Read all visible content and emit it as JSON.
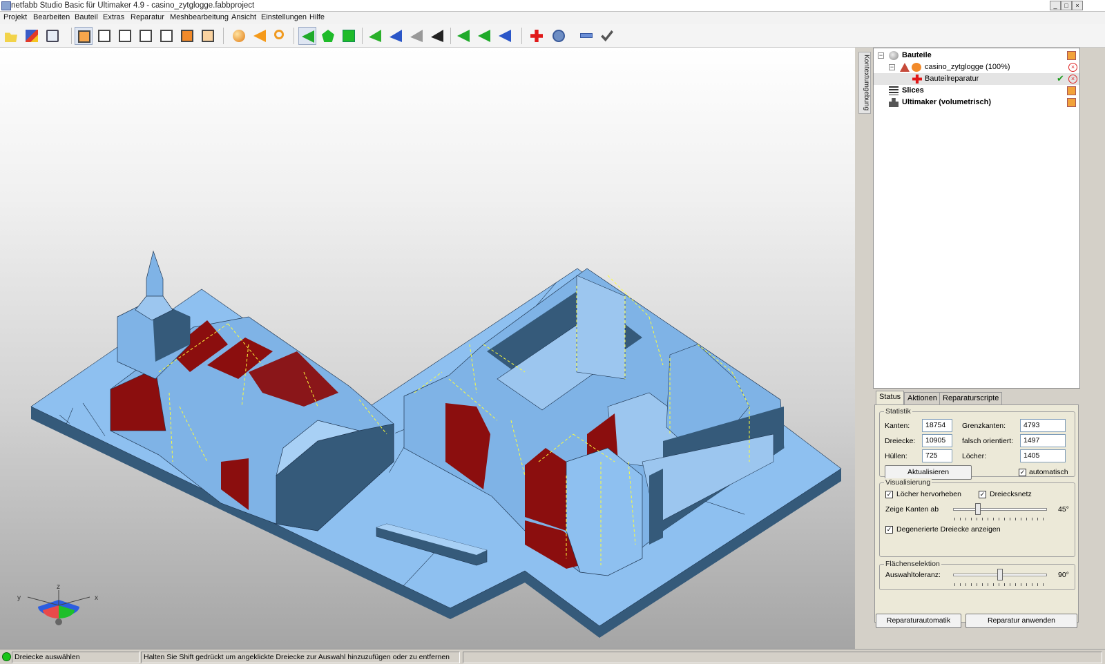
{
  "window": {
    "title": "netfabb Studio Basic für Ultimaker 4.9 - casino_zytglogge.fabbproject"
  },
  "menu": [
    "Projekt",
    "Bearbeiten",
    "Bauteil",
    "Extras",
    "Reparatur",
    "Meshbearbeitung",
    "Ansicht",
    "Einstellungen",
    "Hilfe"
  ],
  "toolbar": {
    "icons": [
      "open-folder-icon",
      "add-part-icon",
      "part-info-icon",
      "view-standard-icon",
      "view-front-icon",
      "view-back-icon",
      "view-left-icon",
      "view-right-icon",
      "view-top-icon",
      "view-bottom-icon",
      "sphere-render-icon",
      "pointer-icon",
      "zoom-icon",
      "select-triangle-icon",
      "select-shell-icon",
      "select-surface-icon",
      "add-triangle-icon",
      "add-triangle-point-icon",
      "remove-triangle-icon",
      "triangle-tool-icon",
      "move-left-icon",
      "move-mid-icon",
      "move-right-icon",
      "repair-cross-icon",
      "measure-dropdown-icon",
      "ruler-icon",
      "check-icon"
    ]
  },
  "sidetab": {
    "label": "Kontextumgebung"
  },
  "tree": {
    "items": [
      {
        "label": "Bauteile",
        "bold": true,
        "level": 0
      },
      {
        "label": "casino_zytglogge (100%)",
        "bold": false,
        "level": 1
      },
      {
        "label": "Bauteilreparatur",
        "bold": false,
        "level": 2
      },
      {
        "label": "Slices",
        "bold": true,
        "level": 0
      },
      {
        "label": "Ultimaker (volumetrisch)",
        "bold": true,
        "level": 0
      }
    ]
  },
  "tabs": [
    "Status",
    "Aktionen",
    "Reparaturscripte"
  ],
  "statistik": {
    "title": "Statistik",
    "kanten_label": "Kanten:",
    "kanten": "18754",
    "grenzkanten_label": "Grenzkanten:",
    "grenzkanten": "4793",
    "dreiecke_label": "Dreiecke:",
    "dreiecke": "10905",
    "falsch_label": "falsch orientiert:",
    "falsch": "1497",
    "huellen_label": "Hüllen:",
    "huellen": "725",
    "loecher_label": "Löcher:",
    "loecher": "1405",
    "update_button": "Aktualisieren",
    "auto_label": "automatisch",
    "auto_checked": true
  },
  "visualisierung": {
    "title": "Visualisierung",
    "holes_label": "Löcher hervorheben",
    "holes_checked": true,
    "mesh_label": "Dreiecksnetz",
    "mesh_checked": true,
    "edges_label": "Zeige Kanten ab",
    "edges_value": "45°",
    "edges_fraction": 0.25,
    "degenerate_label": "Degenerierte Dreiecke anzeigen",
    "degenerate_checked": true
  },
  "flaechen": {
    "title": "Flächenselektion",
    "tol_label": "Auswahltoleranz:",
    "tol_value": "90°",
    "tol_fraction": 0.5
  },
  "buttons": {
    "auto_repair": "Reparaturautomatik",
    "apply_repair": "Reparatur anwenden"
  },
  "axes": {
    "x": "x",
    "y": "y",
    "z": "z"
  },
  "statusbar": {
    "mode": "Dreiecke auswählen",
    "hint": "Halten Sie Shift gedrückt um angeklickte Dreiecke zur Auswahl hinzuzufügen oder zu entfernen"
  },
  "colors": {
    "mesh": "#8ec0f0",
    "mesh_dark": "#355a7a",
    "hole": "#8b0e0e",
    "edge": "#ffff3a",
    "wire": "#1e3550"
  }
}
